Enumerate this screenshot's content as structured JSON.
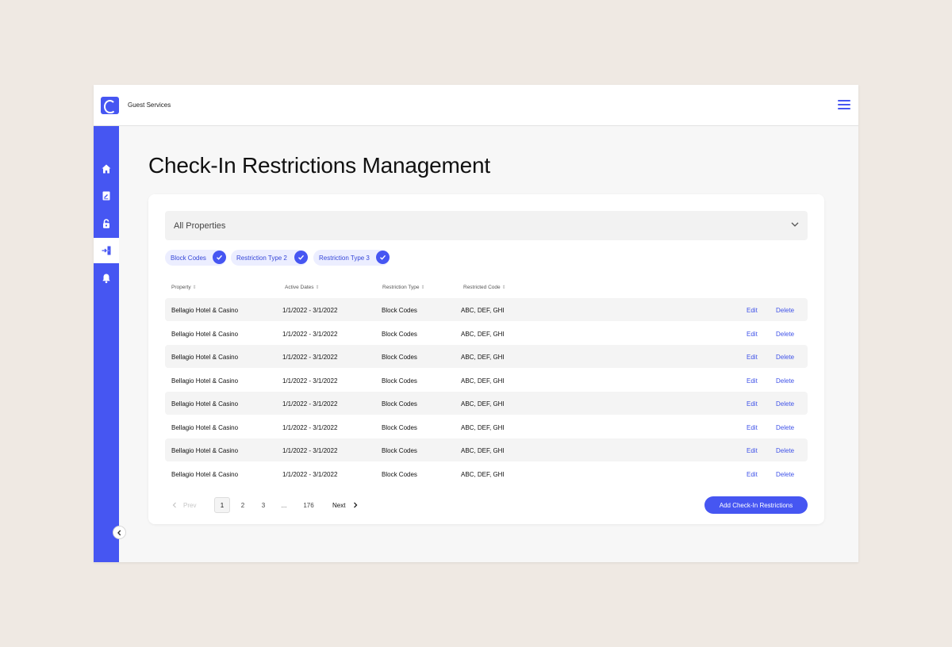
{
  "app": {
    "name": "Guest Services"
  },
  "page": {
    "title": "Check-In Restrictions Management"
  },
  "filter": {
    "selected": "All Properties"
  },
  "chips": [
    "Block Codes",
    "Restriction Type 2",
    "Restriction Type 3"
  ],
  "columns": [
    "Property",
    "Active Dates",
    "Restriction Type",
    "Restricted Code"
  ],
  "row_actions": {
    "edit": "Edit",
    "delete": "Delete"
  },
  "rows": [
    [
      "Bellagio Hotel & Casino",
      "1/1/2022 - 3/1/2022",
      "Block Codes",
      "ABC, DEF, GHI"
    ],
    [
      "Bellagio Hotel & Casino",
      "1/1/2022 - 3/1/2022",
      "Block Codes",
      "ABC, DEF, GHI"
    ],
    [
      "Bellagio Hotel & Casino",
      "1/1/2022 - 3/1/2022",
      "Block Codes",
      "ABC, DEF, GHI"
    ],
    [
      "Bellagio Hotel & Casino",
      "1/1/2022 - 3/1/2022",
      "Block Codes",
      "ABC, DEF, GHI"
    ],
    [
      "Bellagio Hotel & Casino",
      "1/1/2022 - 3/1/2022",
      "Block Codes",
      "ABC, DEF, GHI"
    ],
    [
      "Bellagio Hotel & Casino",
      "1/1/2022 - 3/1/2022",
      "Block Codes",
      "ABC, DEF, GHI"
    ],
    [
      "Bellagio Hotel & Casino",
      "1/1/2022 - 3/1/2022",
      "Block Codes",
      "ABC, DEF, GHI"
    ],
    [
      "Bellagio Hotel & Casino",
      "1/1/2022 - 3/1/2022",
      "Block Codes",
      "ABC, DEF, GHI"
    ]
  ],
  "pagination": {
    "prev": "Prev",
    "pages": [
      "1",
      "2",
      "3",
      "...",
      "176"
    ],
    "current": "1",
    "next": "Next"
  },
  "actions": {
    "add": "Add Check-In Restrictions"
  },
  "sidebar": {
    "items": [
      {
        "icon": "home-icon"
      },
      {
        "icon": "document-edit-icon"
      },
      {
        "icon": "lock-icon"
      },
      {
        "icon": "check-in-door-icon",
        "active": true
      },
      {
        "icon": "bell-icon"
      }
    ]
  },
  "colors": {
    "accent": "#4656f2",
    "background": "#efe9e3"
  }
}
